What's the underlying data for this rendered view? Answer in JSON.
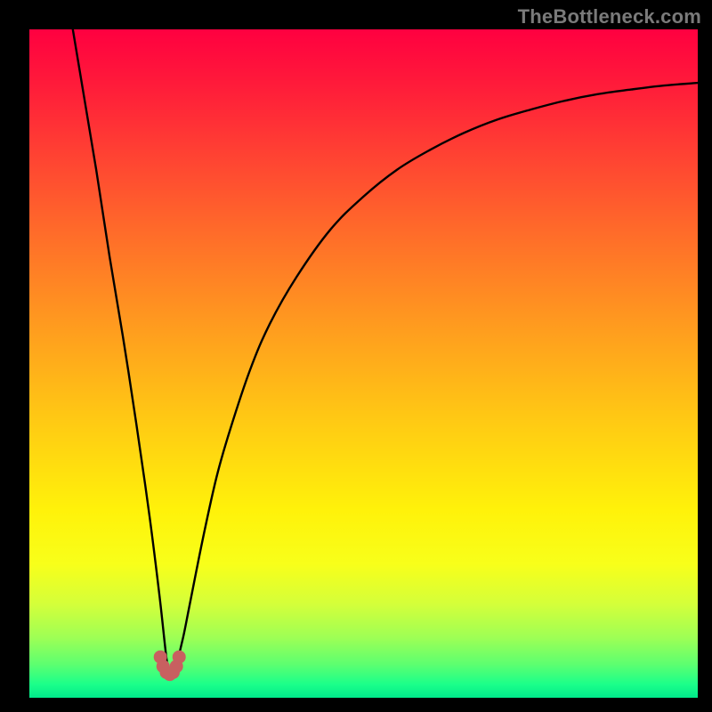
{
  "watermark": "TheBottleneck.com",
  "chart_data": {
    "type": "line",
    "title": "",
    "xlabel": "",
    "ylabel": "",
    "xlim": [
      0,
      100
    ],
    "ylim": [
      0,
      100
    ],
    "grid": false,
    "note": "Values are approximate readings of the black bottleneck curve; bottom-left origin. x is horizontal position (0–100), y is curve height (0–100). Minimum near x≈21.",
    "series": [
      {
        "name": "bottleneck-curve",
        "x": [
          6.5,
          8,
          10,
          12,
          14,
          16,
          18,
          19.5,
          20.5,
          21,
          21.5,
          22,
          23,
          24,
          26,
          28,
          30,
          33,
          36,
          40,
          45,
          50,
          55,
          60,
          65,
          70,
          75,
          80,
          85,
          90,
          95,
          100
        ],
        "y": [
          100,
          91,
          79,
          66,
          54,
          41,
          27,
          15,
          6,
          3.5,
          3.6,
          5,
          9,
          14,
          24,
          33,
          40,
          49,
          56,
          63,
          70,
          75,
          79,
          82,
          84.5,
          86.5,
          88,
          89.3,
          90.3,
          91,
          91.6,
          92
        ]
      }
    ],
    "annotations": {
      "minimum_x": 21,
      "minimum_marker_color": "#c86060"
    }
  }
}
